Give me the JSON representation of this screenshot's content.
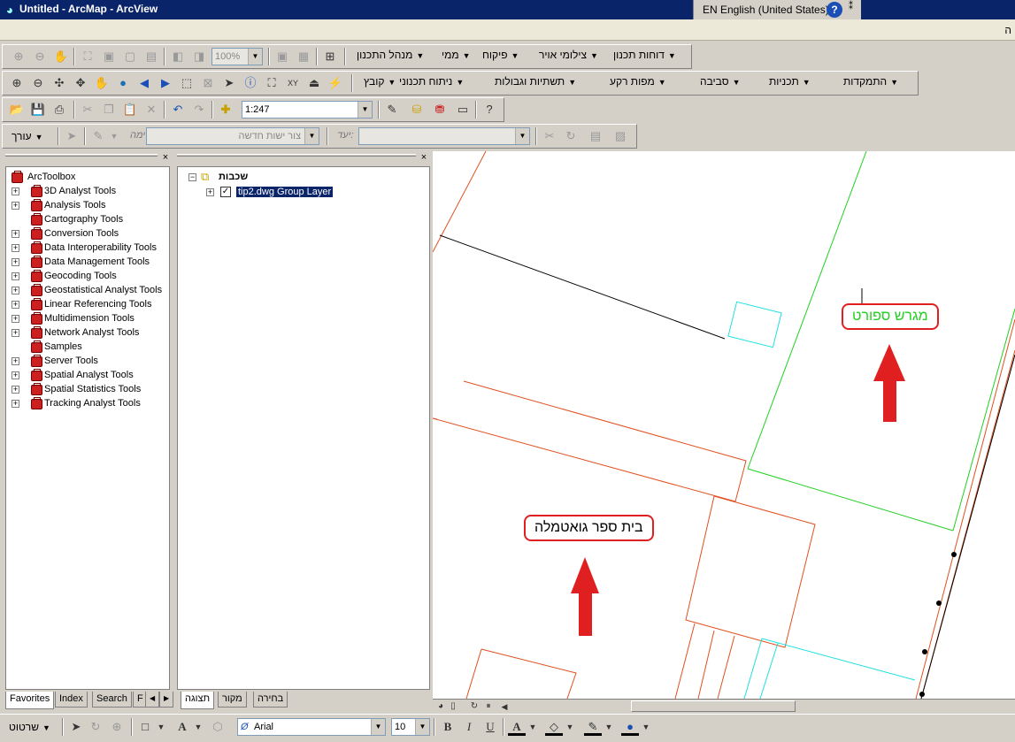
{
  "window": {
    "title": "Untitled - ArcMap - ArcView"
  },
  "langbar": {
    "language": "EN English (United States)",
    "help": "?",
    "more": "⁑"
  },
  "menubar": {
    "fragment": "ה"
  },
  "toolbar1": {
    "zoom": "100%",
    "menus": [
      "דוחות תכנון",
      "צילומי אויר",
      "פיקוח",
      "ממי",
      "מנהל התכנון"
    ]
  },
  "toolbar2": {
    "menus": [
      "התמקדות",
      "תכניות",
      "סביבה",
      "מפות רקע",
      "תשתיות וגבולות",
      "ניתוח תכנוני",
      "קובץ"
    ]
  },
  "toolbar3": {
    "scale": "1:247"
  },
  "editor": {
    "label": "עורך",
    "task_label": "משימה:",
    "task_value": "צור ישות חדשה",
    "target_label": "יעד:",
    "target_value": ""
  },
  "toolbox": {
    "root": "ArcToolbox",
    "items": [
      "3D Analyst Tools",
      "Analysis Tools",
      "Cartography Tools",
      "Conversion Tools",
      "Data Interoperability Tools",
      "Data Management Tools",
      "Geocoding Tools",
      "Geostatistical Analyst Tools",
      "Linear Referencing Tools",
      "Multidimension Tools",
      "Network Analyst Tools",
      "Samples",
      "Server Tools",
      "Spatial Analyst Tools",
      "Spatial Statistics Tools",
      "Tracking Analyst Tools"
    ],
    "tabs": [
      "Favorites",
      "Index",
      "Search",
      "F"
    ]
  },
  "toc": {
    "root": "שכבות",
    "layer": "tip2.dwg Group Layer",
    "tabs": [
      "תצוגה",
      "מקור",
      "בחירה"
    ]
  },
  "map": {
    "label_sport": "מגרש ספורט",
    "label_school": "בית ספר גואטמלה",
    "colors": {
      "parcel": "#e05020",
      "green": "#20d020",
      "cyan": "#20e0e0",
      "arrow": "#e02020"
    }
  },
  "drawing": {
    "label": "שרטוט",
    "font": "Arial",
    "size": "10",
    "bold": "B",
    "italic": "I",
    "underline": "U",
    "font_color": "A"
  }
}
